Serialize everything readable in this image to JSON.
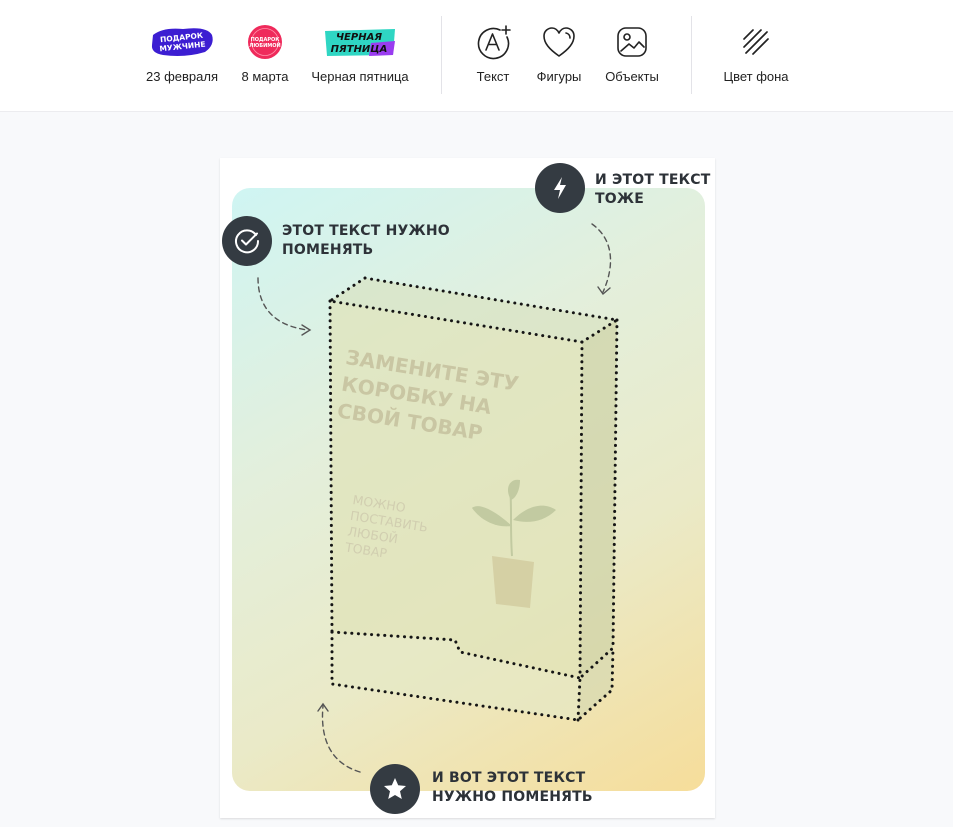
{
  "toolbar": {
    "items": [
      {
        "label": "23 февраля",
        "sticker_text": "ПОДАРОК МУЖЧИНЕ"
      },
      {
        "label": "8 марта",
        "sticker_text": "ПОДАРОК ЛЮБИМОЙ"
      },
      {
        "label": "Черная пятница",
        "sticker_text": "ЧЕРНАЯ ПЯТНИЦА"
      },
      {
        "label": "Текст",
        "icon": "add-text-icon"
      },
      {
        "label": "Фигуры",
        "icon": "heart-icon"
      },
      {
        "label": "Объекты",
        "icon": "image-icon"
      },
      {
        "label": "Цвет фона",
        "icon": "hatch-pattern-icon"
      }
    ]
  },
  "canvas": {
    "note_left": "ЭТОТ ТЕКСТ НУЖНО\nПОМЕНЯТЬ",
    "note_right": "И ЭТОТ ТЕКСТ\nТОЖЕ",
    "note_bottom": "И ВОТ ЭТОТ ТЕКСТ\nНУЖНО ПОМЕНЯТЬ",
    "box_title": "ЗАМЕНИТЕ ЭТУ\nКОРОБКУ НА\nСВОЙ ТОВАР",
    "box_subtitle": "Можно\nпоставить\nлюбой\nтовар"
  },
  "colors": {
    "badge": "#343b42",
    "sticker_purple": "#3c1ed2",
    "sticker_pink": "#ef2a5b",
    "sticker_teal": "#2fd6c3",
    "sticker_violet": "#9a3cf0"
  }
}
